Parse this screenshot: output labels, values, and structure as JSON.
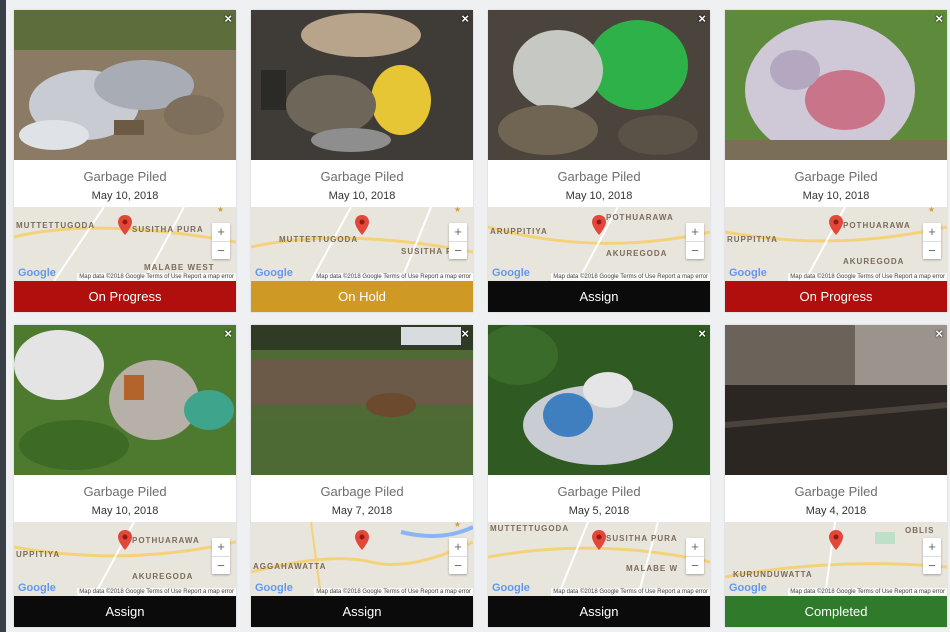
{
  "map_attribution": "Map data ©2018 Google   Terms of Use   Report a map error",
  "google_label": "Google",
  "zoom_in": "+",
  "zoom_out": "−",
  "close_label": "×",
  "colors": {
    "on_progress": "#b10e0e",
    "on_hold": "#cf9a23",
    "assign": "#0b0b0b",
    "completed": "#2f7a2b"
  },
  "cards": [
    {
      "title": "Garbage Piled",
      "date": "May 10, 2018",
      "status": "On Progress",
      "status_key": "on_progress",
      "map_labels": [
        "MUTTETTUGODA",
        "SUSITHA PURA",
        "MALABE WEST"
      ]
    },
    {
      "title": "Garbage Piled",
      "date": "May 10, 2018",
      "status": "On Hold",
      "status_key": "on_hold",
      "map_labels": [
        "MUTTETTUGODA",
        "SUSITHA P",
        ""
      ]
    },
    {
      "title": "Garbage Piled",
      "date": "May 10, 2018",
      "status": "Assign",
      "status_key": "assign",
      "map_labels": [
        "POTHUARAWA",
        "ARUPPITIYA",
        "AKUREGODA"
      ]
    },
    {
      "title": "Garbage Piled",
      "date": "May 10, 2018",
      "status": "On Progress",
      "status_key": "on_progress",
      "map_labels": [
        "POTHUARAWA",
        "RUPPITIYA",
        "AKUREGODA"
      ]
    },
    {
      "title": "Garbage Piled",
      "date": "May 10, 2018",
      "status": "Assign",
      "status_key": "assign",
      "map_labels": [
        "POTHUARAWA",
        "UPPITIYA",
        "AKUREGODA"
      ]
    },
    {
      "title": "Garbage Piled",
      "date": "May 7, 2018",
      "status": "Assign",
      "status_key": "assign",
      "map_labels": [
        "AGGAHAWATTA",
        "",
        ""
      ]
    },
    {
      "title": "Garbage Piled",
      "date": "May 5, 2018",
      "status": "Assign",
      "status_key": "assign",
      "map_labels": [
        "MUTTETTUGODA",
        "SUSITHA PURA",
        "MALABE W"
      ]
    },
    {
      "title": "Garbage Piled",
      "date": "May 4, 2018",
      "status": "Completed",
      "status_key": "completed",
      "map_labels": [
        "KURUNDUWATTA",
        "OBLIS",
        ""
      ]
    }
  ]
}
